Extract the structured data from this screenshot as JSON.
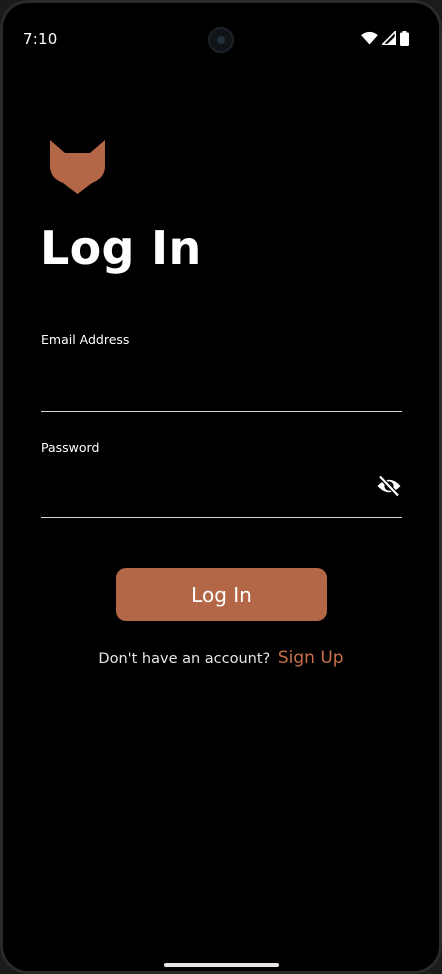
{
  "status_bar": {
    "time": "7:10",
    "icons": [
      "wifi-icon",
      "cellular-signal-icon",
      "battery-icon"
    ]
  },
  "brand": {
    "logo_icon": "fox-head-icon",
    "accent_color": "#b46746",
    "link_color": "#c9704b"
  },
  "screen": {
    "title": "Log In"
  },
  "form": {
    "email": {
      "label": "Email Address",
      "value": "",
      "placeholder": ""
    },
    "password": {
      "label": "Password",
      "value": "",
      "placeholder": "",
      "toggle_icon": "eye-off-icon"
    },
    "submit_label": "Log In"
  },
  "signup": {
    "prompt": "Don't have an account?",
    "link_label": "Sign Up"
  }
}
